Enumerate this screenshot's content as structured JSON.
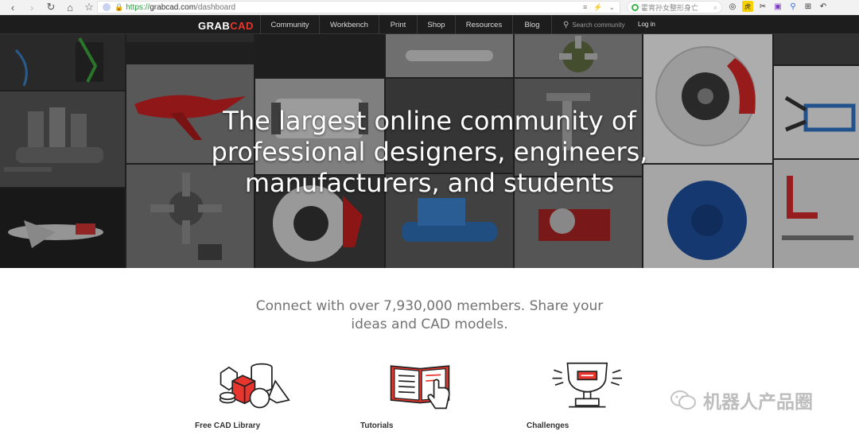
{
  "browser": {
    "url_scheme": "https://",
    "url_host": "grabcad.com",
    "url_path": "/dashboard",
    "search_placeholder": "霍宵孙女整形身亡"
  },
  "site": {
    "logo_grab": "GRAB",
    "logo_cad": "CAD",
    "nav_items": [
      "Community",
      "Workbench",
      "Print",
      "Shop",
      "Resources",
      "Blog"
    ],
    "search_placeholder": "Search community",
    "login_label": "Log in"
  },
  "hero": {
    "title_line1": "The largest online community of",
    "title_line2": "professional designers, engineers,",
    "title_line3": "manufacturers, and students"
  },
  "main": {
    "tagline_line1": "Connect with over 7,930,000 members. Share your",
    "tagline_line2": "ideas and CAD models.",
    "features": [
      {
        "label": "Free CAD Library",
        "icon": "cad-library-icon"
      },
      {
        "label": "Tutorials",
        "icon": "tutorials-icon"
      },
      {
        "label": "Challenges",
        "icon": "challenges-icon"
      }
    ]
  },
  "watermark": {
    "text": "机器人产品圈"
  },
  "colors": {
    "brand_red": "#e8352d",
    "nav_bg": "#1d1d1d",
    "text_gray": "#737373"
  }
}
